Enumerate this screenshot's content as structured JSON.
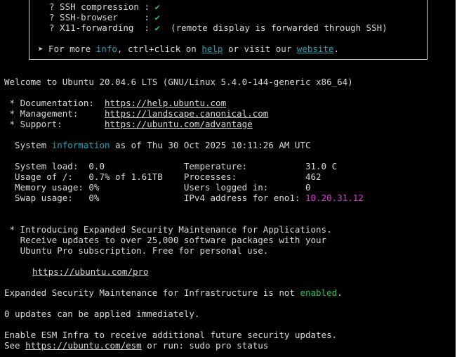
{
  "banner": {
    "features": [
      {
        "label": "? SSH compression",
        "sep": " : ",
        "status": "✔",
        "note": ""
      },
      {
        "label": "? SSH-browser    ",
        "sep": " : ",
        "status": "✔",
        "note": ""
      },
      {
        "label": "? X11-forwarding ",
        "sep": " : ",
        "status": "✔",
        "note": "  (remote display is forwarded through SSH)"
      }
    ],
    "more": {
      "prefix": "➤ For more ",
      "info": "info",
      "mid1": ", ctrl+click on ",
      "help": "help",
      "mid2": " or visit our ",
      "website": "website",
      "suffix": "."
    }
  },
  "welcome": "Welcome to Ubuntu 20.04.6 LTS (GNU/Linux 5.4.0-144-generic x86_64)",
  "links": [
    {
      "label": " * Documentation:  ",
      "url": "https://help.ubuntu.com"
    },
    {
      "label": " * Management:     ",
      "url": "https://landscape.canonical.com"
    },
    {
      "label": " * Support:        ",
      "url": "https://ubuntu.com/advantage"
    }
  ],
  "sysinfo": {
    "prefix": "  System ",
    "word": "information",
    "suffix": " as of Thu 30 Oct 2025 10:11:26 AM UTC"
  },
  "stats": [
    {
      "left": "  System load:  0.0               ",
      "right": "Temperature:           ",
      "value": "31.0 C"
    },
    {
      "left": "  Usage of /:   0.7% of 1.61TB    ",
      "right": "Processes:             ",
      "value": "462"
    },
    {
      "left": "  Memory usage: 0%                ",
      "right": "Users logged in:       ",
      "value": "0"
    },
    {
      "left": "  Swap usage:   0%                ",
      "right": "IPv4 address for eno1: ",
      "value": "10.20.31.12"
    }
  ],
  "esm_apps": [
    " * Introducing Expanded Security Maintenance for Applications.",
    "   Receive updates to over 25,000 software packages with your",
    "   Ubuntu Pro subscription. Free for personal use."
  ],
  "pro_url": "https://ubuntu.com/pro",
  "esm_infra": {
    "prefix": "Expanded Security Maintenance for Infrastructure is not ",
    "word": "enabled",
    "suffix": "."
  },
  "updates": "0 updates can be applied immediately.",
  "enable": "Enable ESM Infra to receive additional future security updates.",
  "see": {
    "prefix": "See ",
    "url": "https://ubuntu.com/esm",
    "suffix": " or run: sudo pro status"
  }
}
